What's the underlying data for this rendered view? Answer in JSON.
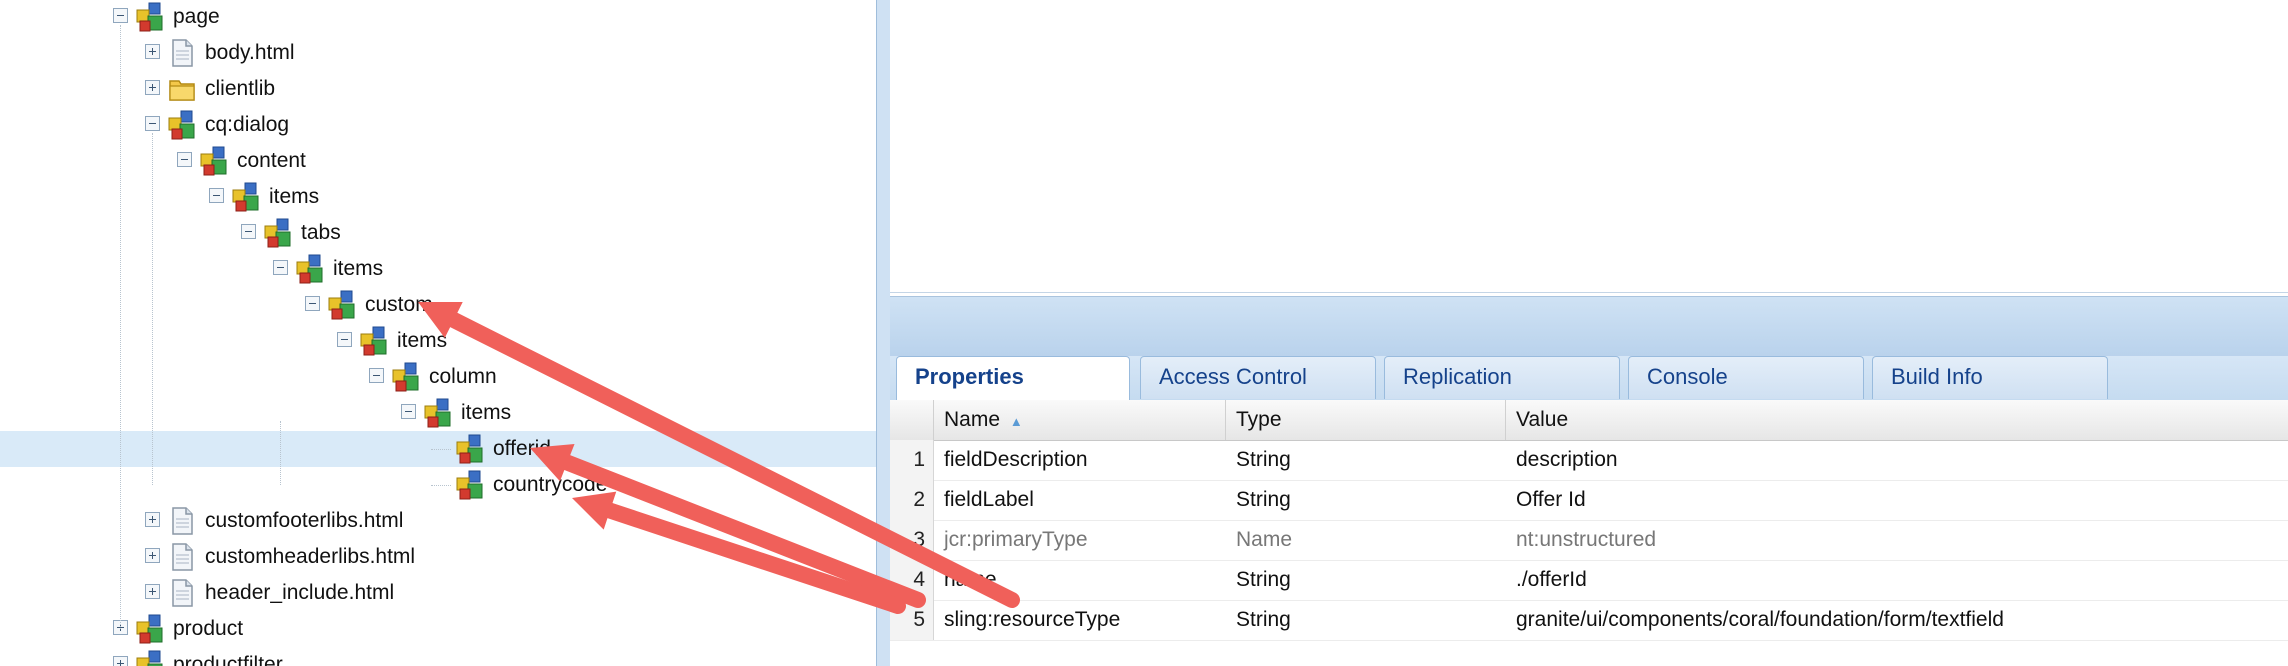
{
  "tree": {
    "nodes": [
      {
        "label": "page",
        "icon": "node-icon",
        "toggle": "minus"
      },
      {
        "label": "body.html",
        "icon": "file-icon",
        "toggle": "plus"
      },
      {
        "label": "clientlib",
        "icon": "folder-icon",
        "toggle": "plus"
      },
      {
        "label": "cq:dialog",
        "icon": "node-icon",
        "toggle": "minus"
      },
      {
        "label": "content",
        "icon": "node-icon",
        "toggle": "minus"
      },
      {
        "label": "items",
        "icon": "node-icon",
        "toggle": "minus"
      },
      {
        "label": "tabs",
        "icon": "node-icon",
        "toggle": "minus"
      },
      {
        "label": "items",
        "icon": "node-icon",
        "toggle": "minus"
      },
      {
        "label": "custom",
        "icon": "node-icon",
        "toggle": "minus"
      },
      {
        "label": "items",
        "icon": "node-icon",
        "toggle": "minus"
      },
      {
        "label": "column",
        "icon": "node-icon",
        "toggle": "minus"
      },
      {
        "label": "items",
        "icon": "node-icon",
        "toggle": "minus"
      },
      {
        "label": "offerid",
        "icon": "node-icon",
        "toggle": "none",
        "selected": true
      },
      {
        "label": "countrycode",
        "icon": "node-icon",
        "toggle": "none"
      },
      {
        "label": "customfooterlibs.html",
        "icon": "file-icon",
        "toggle": "plus"
      },
      {
        "label": "customheaderlibs.html",
        "icon": "file-icon",
        "toggle": "plus"
      },
      {
        "label": "header_include.html",
        "icon": "file-icon",
        "toggle": "plus"
      },
      {
        "label": "product",
        "icon": "node-icon",
        "toggle": "plus"
      },
      {
        "label": "productfilter",
        "icon": "node-icon",
        "toggle": "plus"
      }
    ]
  },
  "tabs": [
    {
      "label": "Properties",
      "active": true
    },
    {
      "label": "Access Control",
      "active": false
    },
    {
      "label": "Replication",
      "active": false
    },
    {
      "label": "Console",
      "active": false
    },
    {
      "label": "Build Info",
      "active": false
    }
  ],
  "grid": {
    "columns": [
      "Name",
      "Type",
      "Value"
    ],
    "sort_indicator": "▲",
    "rows": [
      {
        "num": "1",
        "name": "fieldDescription",
        "type": "String",
        "value": "description"
      },
      {
        "num": "2",
        "name": "fieldLabel",
        "type": "String",
        "value": "Offer Id"
      },
      {
        "num": "3",
        "name": "jcr:primaryType",
        "type": "Name",
        "value": "nt:unstructured",
        "dim": true
      },
      {
        "num": "4",
        "name": "name",
        "type": "String",
        "value": "./offerId"
      },
      {
        "num": "5",
        "name": "sling:resourceType",
        "type": "String",
        "value": "granite/ui/components/coral/foundation/form/textfield"
      }
    ]
  },
  "colors": {
    "arrow": "#f0605a",
    "selected_row": "#d9eaf8",
    "tab_text": "#15428b"
  }
}
